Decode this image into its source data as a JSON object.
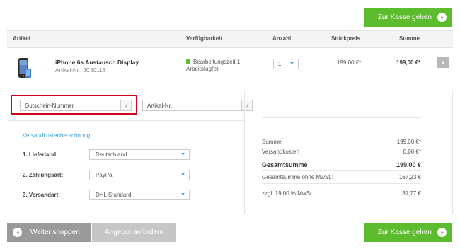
{
  "checkout": {
    "label": "Zur Kasse gehen"
  },
  "table": {
    "headers": {
      "artikel": "Artikel",
      "verfuegbarkeit": "Verfügbarkeit",
      "anzahl": "Anzahl",
      "stueckpreis": "Stückpreis",
      "summe": "Summe"
    },
    "item": {
      "name": "iPhone 6s Austausch Display",
      "sku": "Artikel-Nr.: JC50116",
      "availability_line1": "Bearbeitungszeit 1",
      "availability_line2": "Arbeitstag(e)",
      "quantity": "1",
      "unit_price": "199,00 €*",
      "total": "199,00 €*",
      "remove_icon": "x"
    }
  },
  "voucher": {
    "placeholder": "Gutschein-Nummer",
    "article_placeholder": "Artikel-Nr.:"
  },
  "shipping": {
    "title": "Versandkostenberechnung",
    "country_label": "1. Lieferland:",
    "country_value": "Deutschland",
    "payment_label": "2. Zahlungsart:",
    "payment_value": "PayPal",
    "method_label": "3. Versandart:",
    "method_value": "DHL Standard"
  },
  "summary": {
    "sum_label": "Summe",
    "sum_value": "199,00 €*",
    "shipping_label": "Versandkosten",
    "shipping_value": "0,00 €*",
    "total_label": "Gesamtsumme",
    "total_value": "199,00 €",
    "net_label": "Gesamtsumme ohne MwSt.:",
    "net_value": "167,23 €",
    "vat_label": "zzgl. 19.00 % MwSt.:",
    "vat_value": "31,77 €"
  },
  "footer": {
    "continue_label": "Weiter shoppen",
    "quote_label": "Angebot anfordern"
  },
  "colors": {
    "accent": "#5dbb2e",
    "link": "#3ba3d9",
    "highlight": "#d0021b"
  }
}
